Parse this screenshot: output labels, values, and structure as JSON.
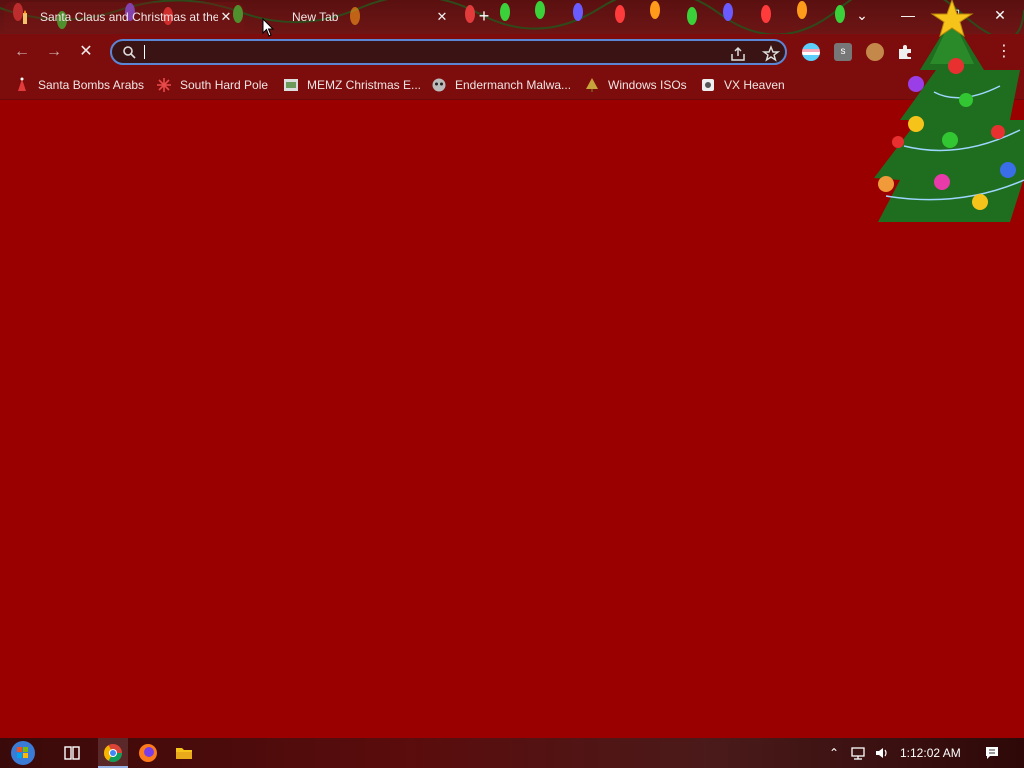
{
  "tabs": [
    {
      "title": "Santa Claus and Christmas at the",
      "active": true
    },
    {
      "title": "New Tab",
      "active": false
    }
  ],
  "window_controls": [
    "tab-search",
    "minimize",
    "maximize",
    "close"
  ],
  "toolbar": {
    "address": {
      "value": "",
      "placeholder": ""
    }
  },
  "bookmarks": [
    {
      "label": "Santa Bombs Arabs",
      "icon": "santa-icon"
    },
    {
      "label": "South Hard Pole",
      "icon": "snowflake-icon"
    },
    {
      "label": "MEMZ Christmas E...",
      "icon": "page-icon"
    },
    {
      "label": "Endermanch Malwa...",
      "icon": "raccoon-icon"
    },
    {
      "label": "Windows ISOs",
      "icon": "tree-icon"
    },
    {
      "label": "VX Heaven",
      "icon": "disk-icon"
    }
  ],
  "taskbar": {
    "clock": "1:12:02 AM"
  },
  "colors": {
    "content_bg": "#9b0000",
    "chrome_bg": "#7d0c0c",
    "omnibox_border": "#5b86d6"
  }
}
